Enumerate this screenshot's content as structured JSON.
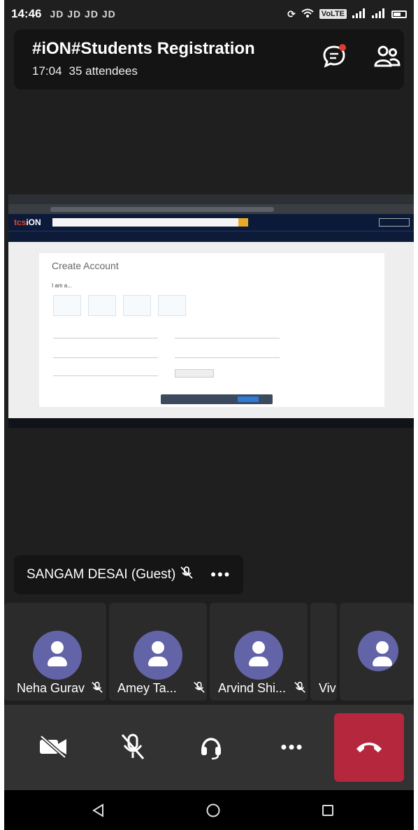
{
  "status_bar": {
    "time": "14:46",
    "notifications": "JD JD JD JD",
    "network": "VoLTE"
  },
  "meeting": {
    "title": "#iON#Students Registration",
    "duration": "17:04",
    "attendees": "35 attendees"
  },
  "shared_screen": {
    "page_heading": "Create Account",
    "role_prompt": "I am a..."
  },
  "presenter": {
    "name": "SANGAM DESAI (Guest)",
    "more": "•••"
  },
  "participants": [
    {
      "name": "Neha Gurav"
    },
    {
      "name": "Amey Ta..."
    },
    {
      "name": "Arvind Shi..."
    },
    {
      "name": "Viv"
    }
  ],
  "controls": {
    "more": "•••"
  },
  "colors": {
    "background": "#201f1f",
    "avatar": "#6264a7",
    "hangup": "#b5273c",
    "notification_dot": "#e53935"
  },
  "icons": {
    "chat": "chat-icon",
    "people": "people-icon",
    "camera_off": "video-off-icon",
    "mic_off": "mic-off-icon",
    "audio": "headset-icon",
    "hangup": "phone-hangup-icon"
  }
}
